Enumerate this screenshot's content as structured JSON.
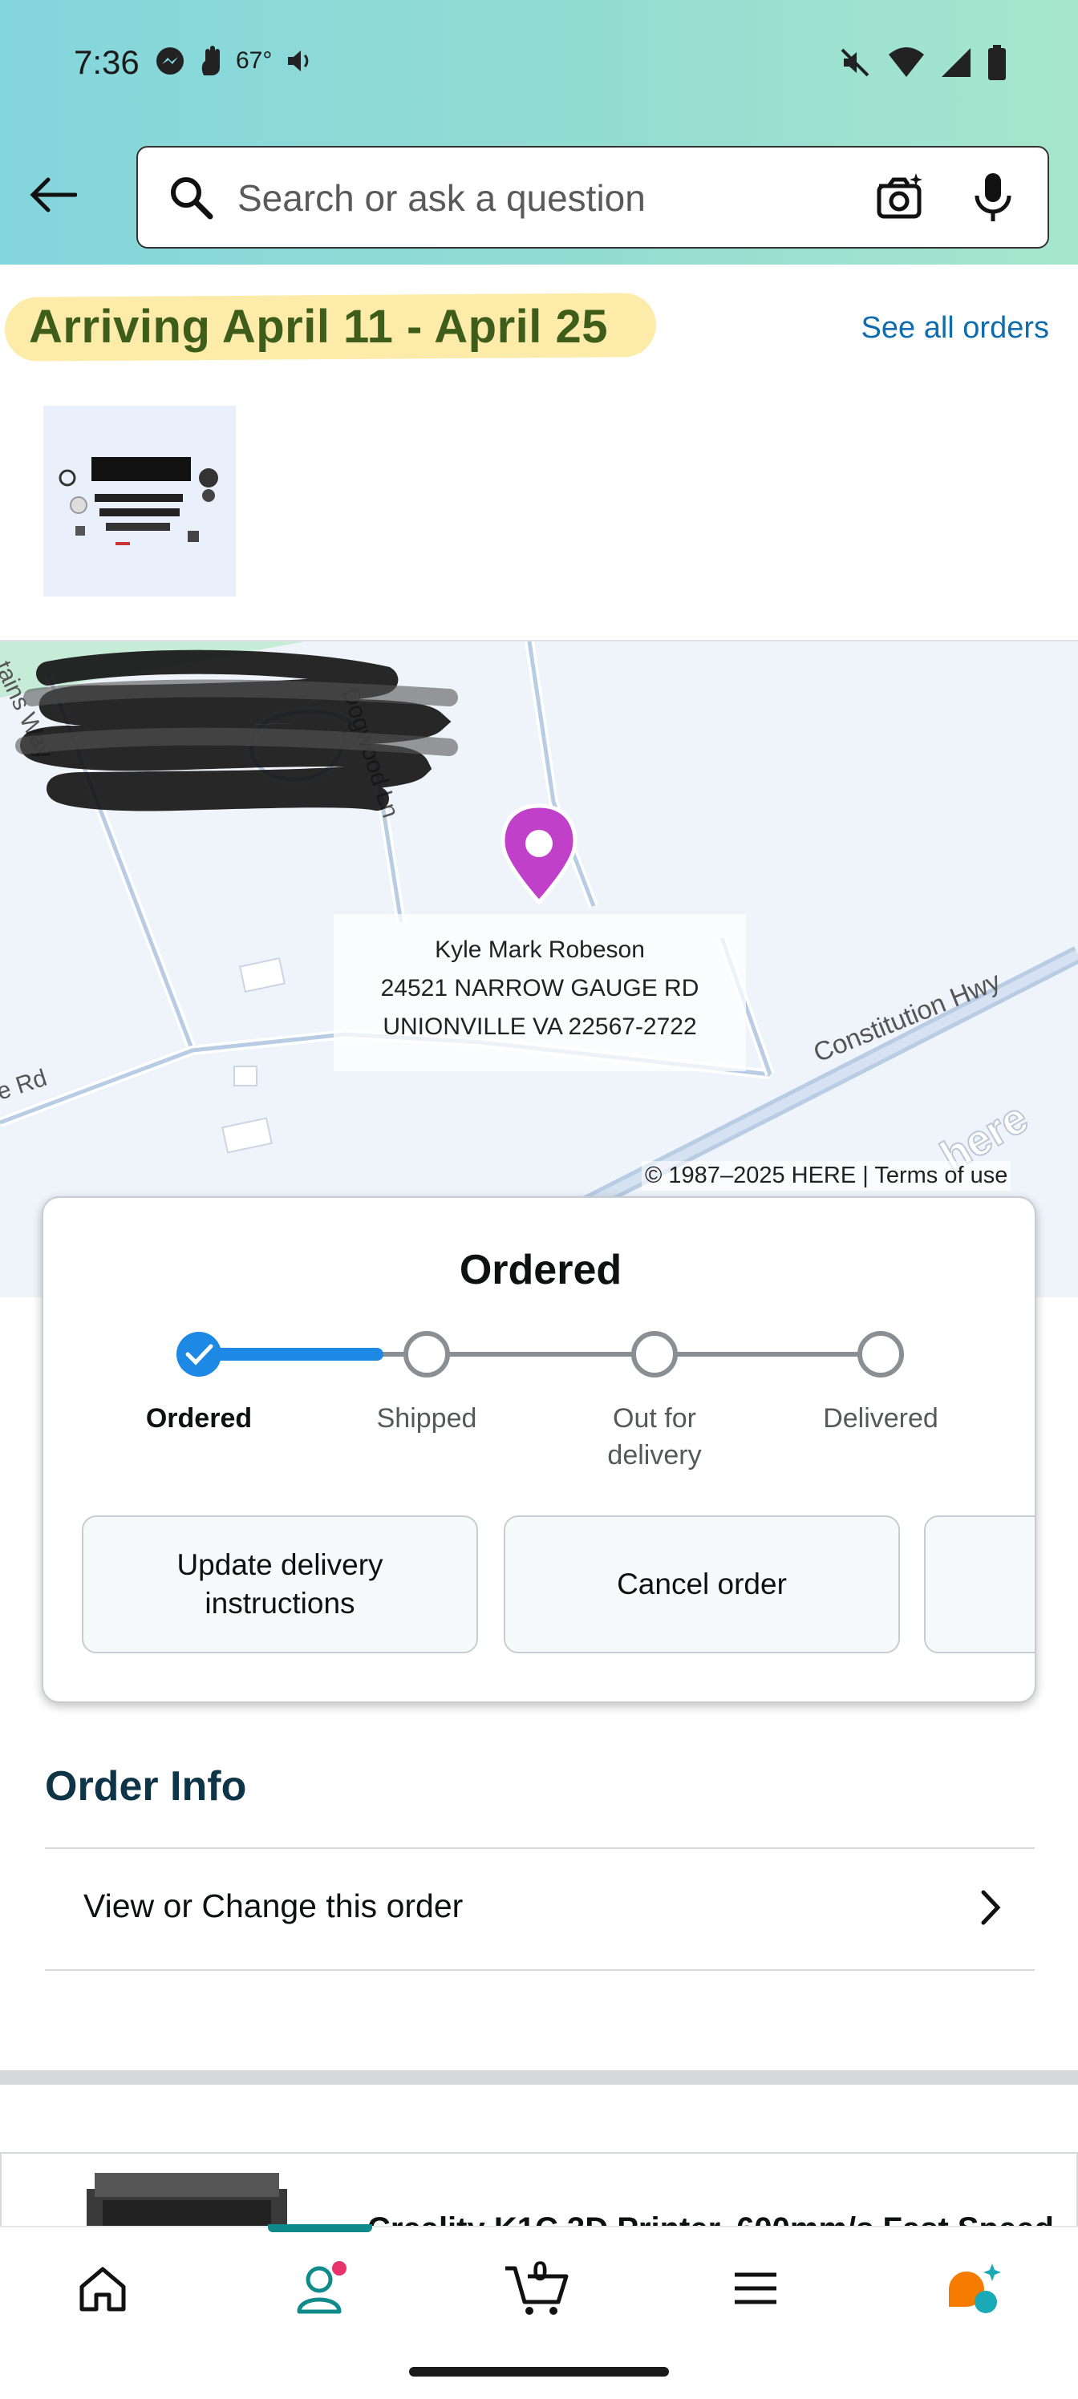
{
  "status_bar": {
    "time": "7:36",
    "temperature": "67°"
  },
  "search": {
    "placeholder": "Search or ask a question"
  },
  "delivery": {
    "arriving_text": "Arriving April 11 - April 25",
    "see_all_orders": "See all orders"
  },
  "map": {
    "roads": [
      "Dogwood Ln",
      "Constitution Hwy",
      "tains Way",
      "e Rd"
    ],
    "address_lines": [
      "Kyle Mark Robeson",
      "24521 NARROW GAUGE RD",
      "UNIONVILLE VA 22567-2722"
    ],
    "copyright": "© 1987–2025 HERE | Terms of use",
    "watermark": "here"
  },
  "tracking": {
    "title": "Ordered",
    "steps": [
      {
        "label": "Ordered",
        "state": "done"
      },
      {
        "label": "Shipped",
        "state": "pending"
      },
      {
        "label": "Out for delivery",
        "state": "pending"
      },
      {
        "label": "Delivered",
        "state": "pending"
      }
    ],
    "actions": [
      "Update delivery instructions",
      "Cancel order"
    ]
  },
  "order_info": {
    "title": "Order Info",
    "view_change": "View or Change this order"
  },
  "product": {
    "title_partial": "Creality K1C 3D Printer, 600mm/s Fast Speed"
  },
  "bottom_nav": {
    "cart_count": "0"
  },
  "colors": {
    "accent": "#1e88e5",
    "link": "#0f6cad",
    "teal": "#0f8a8a",
    "pin": "#c040c9"
  }
}
